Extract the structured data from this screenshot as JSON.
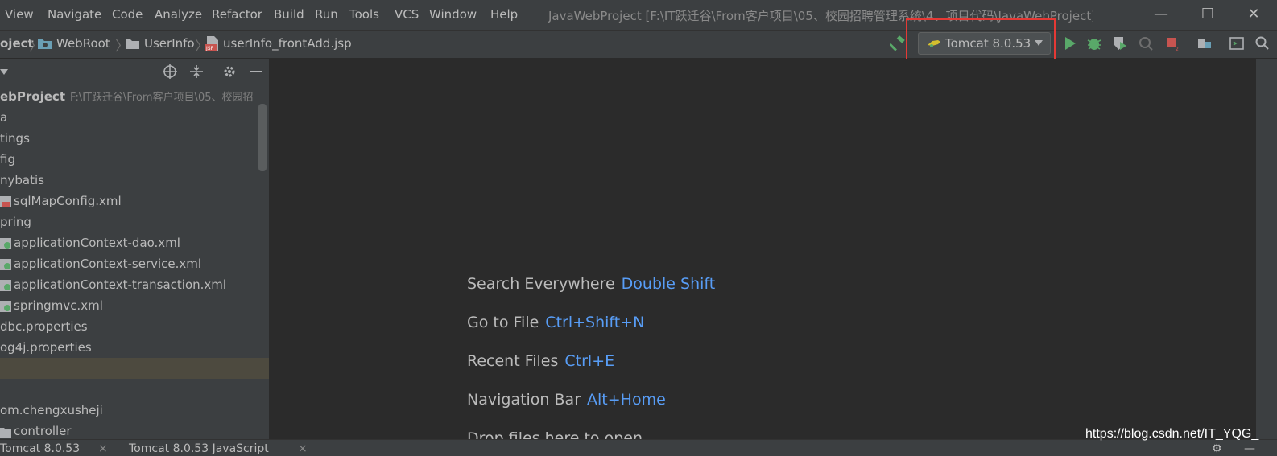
{
  "menu": {
    "items": [
      "View",
      "Navigate",
      "Code",
      "Analyze",
      "Refactor",
      "Build",
      "Run",
      "Tools",
      "VCS",
      "Window",
      "Help"
    ],
    "window_title": "JavaWebProject [F:\\IT跃迁谷\\From客户项目\\05、校园招聘管理系统\\4、项目代码\\JavaWebProject]"
  },
  "breadcrumb": {
    "project": "oject",
    "webroot": "WebRoot",
    "userinfo": "UserInfo",
    "file": "userInfo_frontAdd.jsp"
  },
  "toolbar": {
    "run_config": "Tomcat 8.0.53"
  },
  "project_tree": {
    "root_name": "ebProject",
    "root_path": "F:\\IT跃迁谷\\From客户项目\\05、校园招",
    "rows": [
      "a",
      "tings",
      "fig",
      "nybatis",
      "sqlMapConfig.xml",
      "pring",
      "applicationContext-dao.xml",
      "applicationContext-service.xml",
      "applicationContext-transaction.xml",
      "springmvc.xml",
      "dbc.properties",
      "og4j.properties",
      "",
      "",
      "om.chengxusheji",
      "controller"
    ]
  },
  "editor": {
    "hints": [
      {
        "label": "Search Everywhere",
        "shortcut": "Double Shift"
      },
      {
        "label": "Go to File",
        "shortcut": "Ctrl+Shift+N"
      },
      {
        "label": "Recent Files",
        "shortcut": "Ctrl+E"
      },
      {
        "label": "Navigation Bar",
        "shortcut": "Alt+Home"
      },
      {
        "label": "Drop files here to open",
        "shortcut": ""
      }
    ]
  },
  "bottom_tabs": [
    "Tomcat 8.0.53",
    "Tomcat 8.0.53 JavaScript"
  ],
  "watermark": "https://blog.csdn.net/IT_YQG_",
  "colors": {
    "accent_blue": "#589df6",
    "highlight_red": "#e53935",
    "run_green": "#59a869"
  }
}
